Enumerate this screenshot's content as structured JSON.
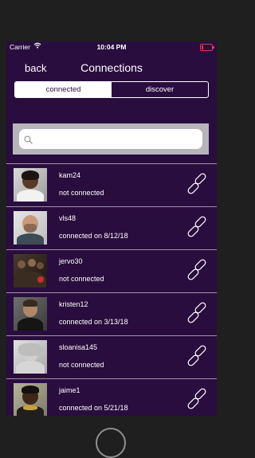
{
  "status_bar": {
    "carrier": "Carrier",
    "time": "10:04 PM",
    "battery_level": 0.15,
    "battery_color": "#e03c3c"
  },
  "nav": {
    "back_label": "back",
    "title": "Connections"
  },
  "segments": {
    "connected_label": "connected",
    "discover_label": "discover",
    "selected": "connected"
  },
  "search": {
    "value": "",
    "placeholder": ""
  },
  "colors": {
    "background": "#2a0d3f",
    "accent": "#ffffff",
    "search_bar_bg": "#b8b4bc"
  },
  "users": [
    {
      "username": "kam24",
      "status": "not connected",
      "icon": "link-icon"
    },
    {
      "username": "vls48",
      "status": "connected on 8/12/18",
      "icon": "link-icon"
    },
    {
      "username": "jervo30",
      "status": "not connected",
      "icon": "link-icon"
    },
    {
      "username": "kristen12",
      "status": "connected on 3/13/18",
      "icon": "link-icon"
    },
    {
      "username": "sloanisa145",
      "status": "not connected",
      "icon": "link-icon"
    },
    {
      "username": "jaime1",
      "status": "connected on 5/21/18",
      "icon": "link-icon"
    }
  ]
}
